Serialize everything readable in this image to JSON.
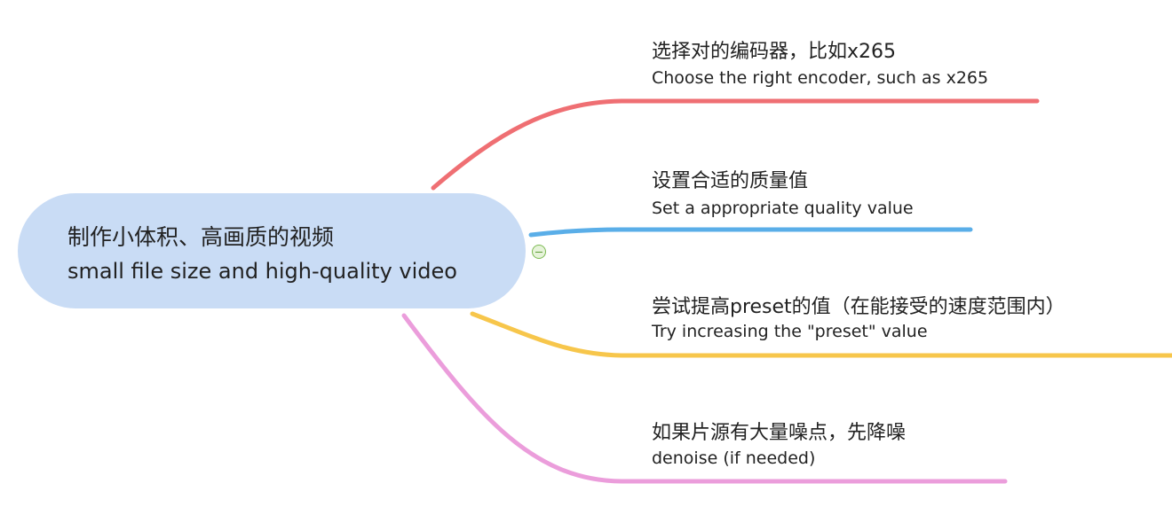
{
  "mindmap": {
    "central": {
      "title": "制作小体积、高画质的视频",
      "subtitle": "small file size and high-quality video",
      "fill_color": "#c9dcf5"
    },
    "collapse_icon": "minus-circle-icon",
    "branches": [
      {
        "title": "选择对的编码器，比如x265",
        "subtitle": "Choose the right encoder, such as x265",
        "color": "#ef6f73"
      },
      {
        "title": "设置合适的质量值",
        "subtitle": "Set a appropriate quality value",
        "color": "#5aaee8"
      },
      {
        "title": "尝试提高preset的值（在能接受的速度范围内）",
        "subtitle": "Try increasing the \"preset\" value",
        "color": "#f7c64b"
      },
      {
        "title": "如果片源有大量噪点，先降噪",
        "subtitle": "denoise (if needed)",
        "color": "#eb9ddb"
      }
    ]
  }
}
